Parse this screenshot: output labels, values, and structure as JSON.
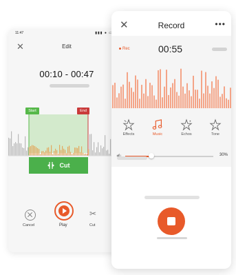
{
  "edit_screen": {
    "status_time": "11:47",
    "status_icons": "▮▮▮ ● ▭",
    "title": "Edit",
    "close_icon": "close-icon",
    "time_range": "00:10 - 00:47",
    "start_label": "Start",
    "end_label": "End",
    "cut_button_label": "Cut",
    "actions": {
      "cancel_label": "Cancel",
      "play_label": "Play",
      "cut_label": "Cut"
    },
    "colors": {
      "start": "#56b849",
      "end": "#c93a3a",
      "cut": "#4bb04b",
      "play": "#e85a2a"
    }
  },
  "record_screen": {
    "title": "Record",
    "menu_icon": "•••",
    "rec_label": "Rec",
    "timer": "00:55",
    "effects": [
      {
        "label": "Effects",
        "icon": "effects-star-icon",
        "active": false
      },
      {
        "label": "Music",
        "icon": "music-note-icon",
        "active": true
      },
      {
        "label": "Echos",
        "icon": "echo-star-icon",
        "active": false
      },
      {
        "label": "Tone",
        "icon": "tone-star-icon",
        "active": false
      }
    ],
    "volume": {
      "value": 0.3,
      "label": "30%"
    },
    "colors": {
      "accent": "#e85a2a",
      "waveform": "#f4a487"
    }
  }
}
